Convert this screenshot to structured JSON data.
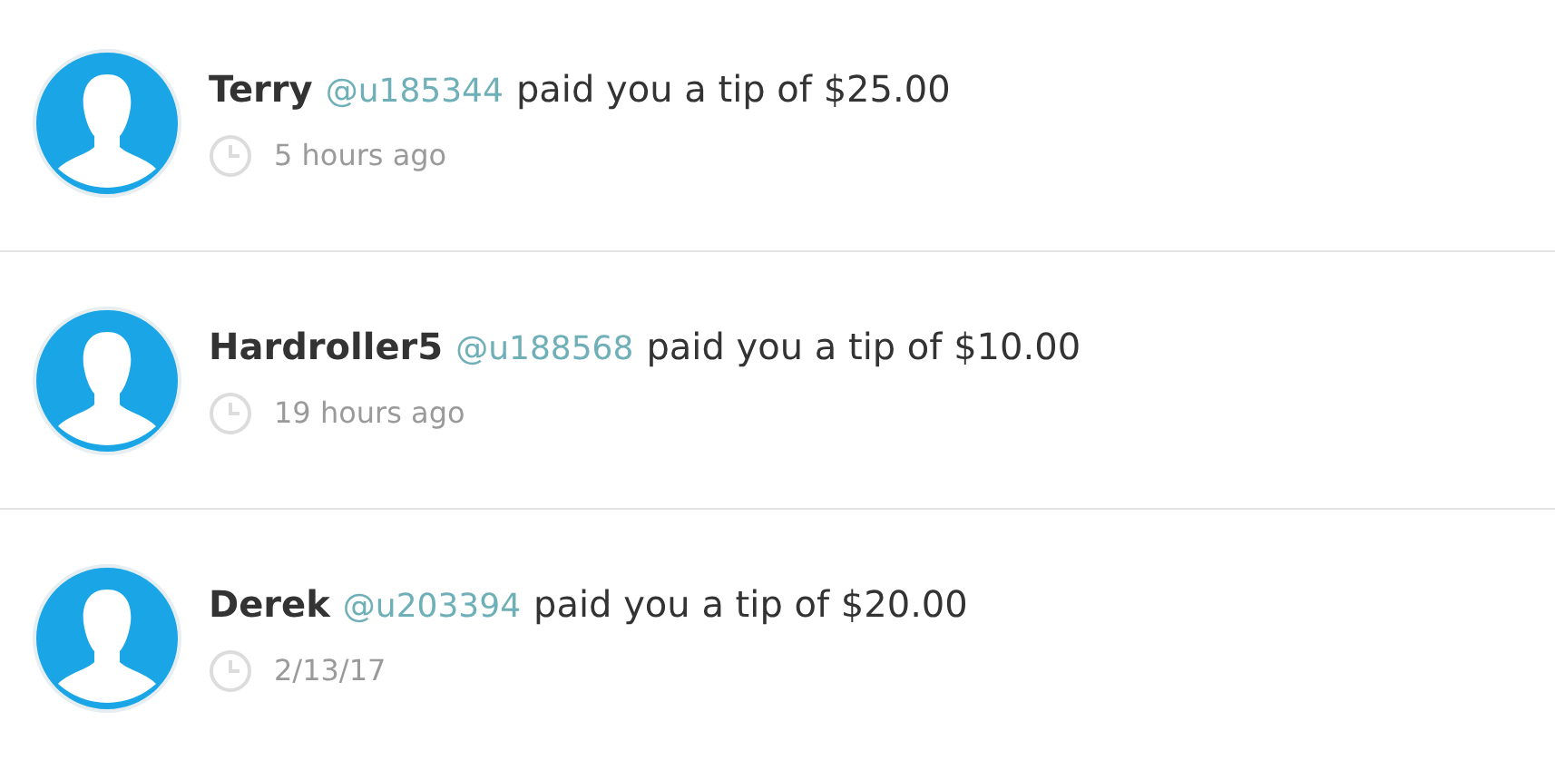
{
  "notifications": [
    {
      "name": "Terry",
      "handle": "@u185344",
      "message": "paid you a tip of $25.00",
      "time": "5 hours ago"
    },
    {
      "name": "Hardroller5",
      "handle": "@u188568",
      "message": "paid you a tip of $10.00",
      "time": "19 hours ago"
    },
    {
      "name": "Derek",
      "handle": "@u203394",
      "message": "paid you a tip of $20.00",
      "time": "2/13/17"
    }
  ]
}
